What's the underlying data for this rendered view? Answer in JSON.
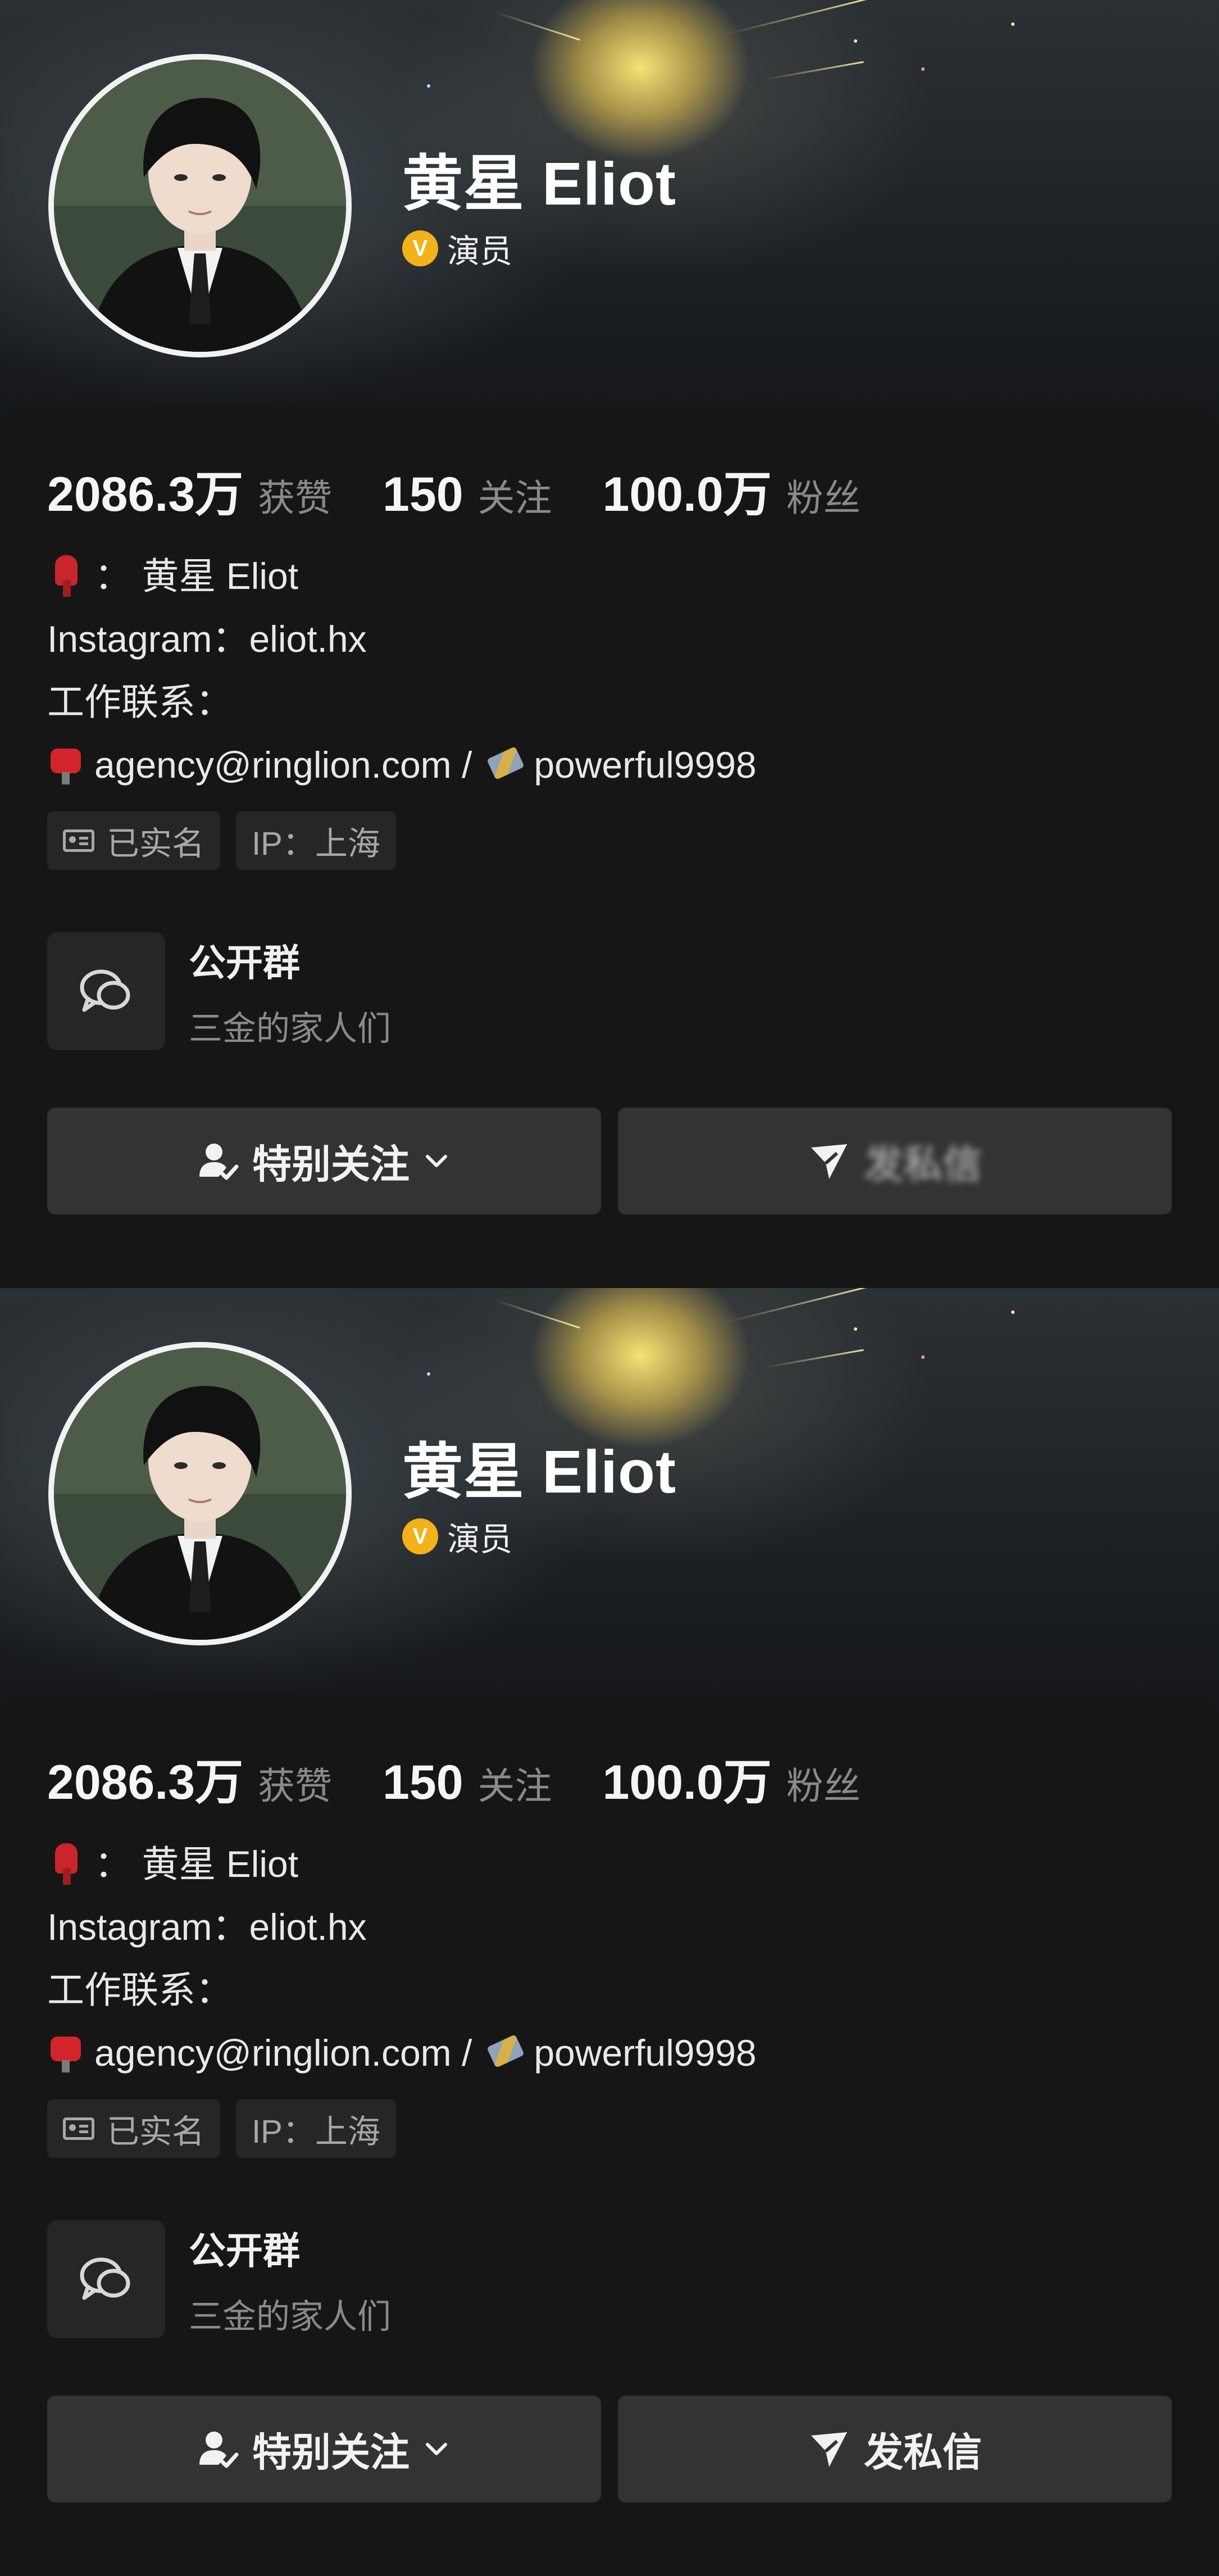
{
  "colors": {
    "background": "#161616",
    "badge": "#f3b21a",
    "button": "#333333",
    "tag": "#262626",
    "muted": "#8a8a8a"
  },
  "profile": {
    "name": "黄星 Eliot",
    "verify_badge": "V",
    "verify_label": "演员",
    "stats": [
      {
        "value": "2086.3万",
        "label": "获赞"
      },
      {
        "value": "150",
        "label": "关注"
      },
      {
        "value": "100.0万",
        "label": "粉丝"
      }
    ],
    "bio": {
      "line1": "： 黄星 Eliot",
      "line2": "Instagram：eliot.hx",
      "line3": "工作联系：",
      "email": "agency@ringlion.com /",
      "wechat": "powerful9998"
    },
    "tags": {
      "verified": "已实名",
      "ip": "IP：上海"
    },
    "group": {
      "title": "公开群",
      "subtitle": "三金的家人们"
    },
    "buttons": {
      "follow": "特别关注",
      "message": "发私信"
    },
    "icons": [
      "scarf-emoji-icon",
      "mailbox-emoji-icon",
      "satellite-emoji-icon",
      "id-card-icon",
      "chat-bubbles-icon",
      "user-check-icon",
      "chevron-down-icon",
      "send-icon"
    ]
  }
}
